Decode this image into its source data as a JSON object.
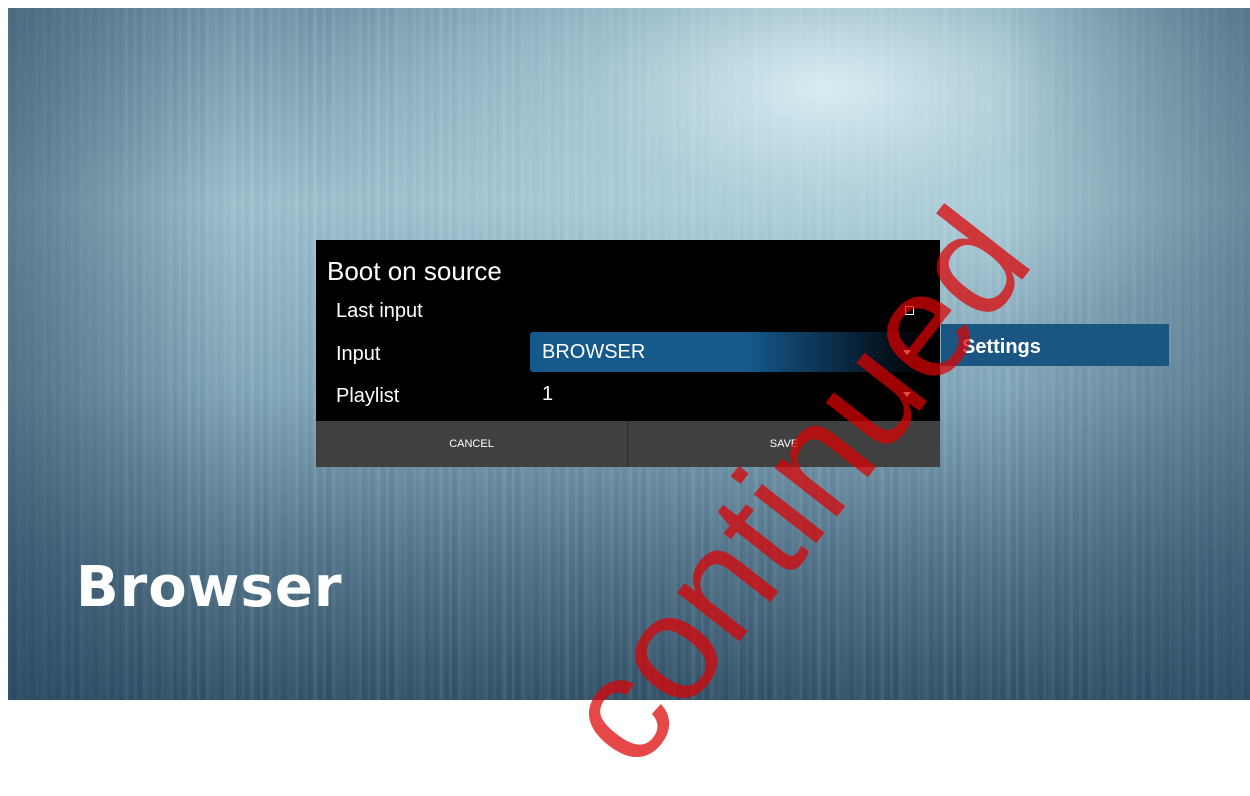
{
  "background": {
    "title": "Browser"
  },
  "dialog": {
    "title": "Boot on source",
    "rows": {
      "last_input": {
        "label": "Last input"
      },
      "input": {
        "label": "Input",
        "value": "BROWSER"
      },
      "playlist": {
        "label": "Playlist",
        "value": "1"
      }
    },
    "buttons": {
      "cancel": "CANCEL",
      "save": "SAVE"
    }
  },
  "side_menu": {
    "settings_label": "Settings"
  },
  "watermark": {
    "text": "continued"
  },
  "colors": {
    "dialog_bg": "#000000",
    "button_bar": "#404040",
    "highlight": "#15588a",
    "settings_bg": "#1b5683",
    "watermark": "#dc0000"
  },
  "icons": {
    "checkbox": "checkbox-unchecked-icon",
    "dropdown": "dropdown-arrow-icon"
  }
}
